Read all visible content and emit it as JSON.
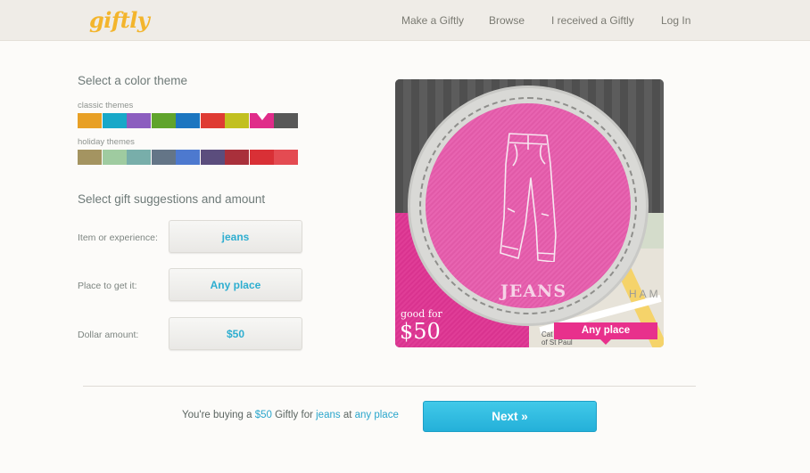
{
  "header": {
    "logo": "giftly",
    "nav": [
      "Make a Giftly",
      "Browse",
      "I received a Giftly",
      "Log In"
    ]
  },
  "theme": {
    "heading": "Select a color theme",
    "classic_label": "classic themes",
    "holiday_label": "holiday themes",
    "classic_colors": [
      "#e8a026",
      "#18a8c8",
      "#8c5ebf",
      "#60a42c",
      "#1c76c0",
      "#df3b33",
      "#c2c020",
      "#e02c8a",
      "#585858"
    ],
    "holiday_colors": [
      "#a49461",
      "#9fcba0",
      "#78aeaa",
      "#647587",
      "#4d79cf",
      "#5b4d7d",
      "#a9303b",
      "#d93036",
      "#e44b52"
    ],
    "selected_classic_index": 7
  },
  "suggestions": {
    "heading": "Select gift suggestions and amount",
    "fields": [
      {
        "label": "Item or experience:",
        "value": "jeans"
      },
      {
        "label": "Place to get it:",
        "value": "Any place"
      },
      {
        "label": "Dollar amount:",
        "value": "$50"
      }
    ]
  },
  "preview": {
    "item_title": "JEANS",
    "good_for": "good for",
    "price": "$50",
    "place": "Any place",
    "map_text": "HAM",
    "map_label_line1": "Cat",
    "map_label_line2": "of St Paul"
  },
  "footer": {
    "summary_prefix": "You're buying a",
    "amount": "$50",
    "summary_mid1": "Giftly for",
    "item": "jeans",
    "summary_mid2": "at",
    "place": "any place",
    "next_label": "Next »"
  }
}
